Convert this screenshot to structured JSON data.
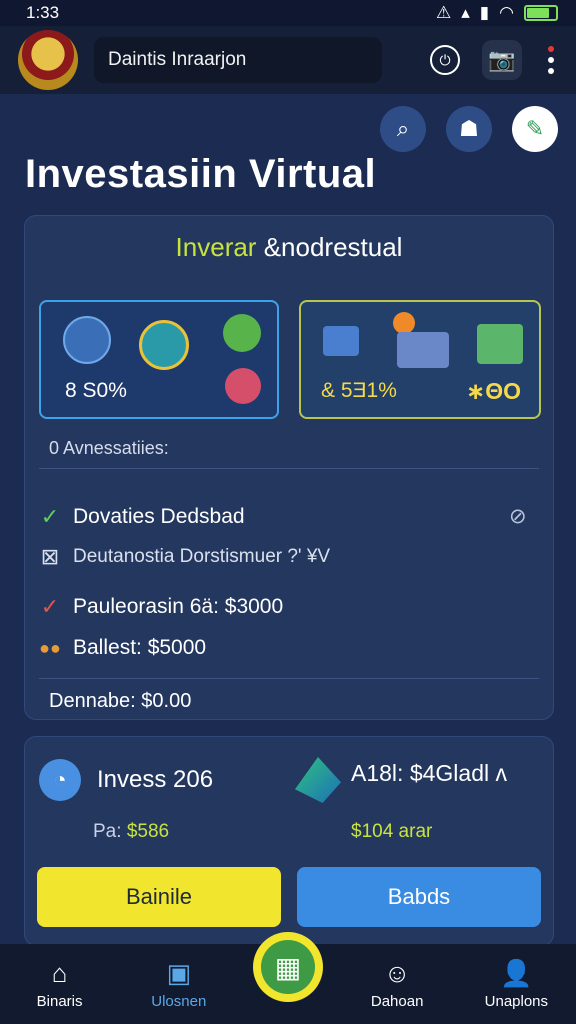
{
  "status": {
    "time": "1:33",
    "icons_left": "⚠",
    "battery_level": 0.8
  },
  "topbar": {
    "search_text": "Daintis Inraarjon",
    "power_icon": "⏻",
    "camera_icon": "📷"
  },
  "quick": {
    "search_icon": "⌕",
    "user_icon": "☗",
    "pen_icon": "✎"
  },
  "page": {
    "title": "Investasiin Virtual"
  },
  "card_a": {
    "title_accent": "Inverar",
    "title_rest": " &nodrestual",
    "tile_left_pct": "8 S0%",
    "tile_right_pct": "& 5Ǝ1%",
    "tile_right_trail": "∗ΘΟ",
    "subtitle": "0 Avnessatiies:",
    "row1": "Dovaties Dedsbad",
    "row2": "Deutanostia Dorstismuer ?' ¥V",
    "row3": "Pauleorasin 6ä: $3000",
    "row4": "Ballest: $5000",
    "footer": "Dennabe: $0.00"
  },
  "card_b": {
    "left_title": "Invess 206",
    "left_sub_label": "Pa: ",
    "left_sub_value": "$586",
    "right_title": "A18l: $4Gladl ᴧ",
    "right_sub": "$104 arar",
    "btn_yellow": "Bainile",
    "btn_blue": "Babds"
  },
  "nav": {
    "items": [
      {
        "label": "Binaris",
        "icon": "⌂"
      },
      {
        "label": "Ulosnen",
        "icon": "▣"
      },
      {
        "label": "Dahoan",
        "icon": "☺"
      },
      {
        "label": "Unaplons",
        "icon": "👤"
      }
    ]
  }
}
